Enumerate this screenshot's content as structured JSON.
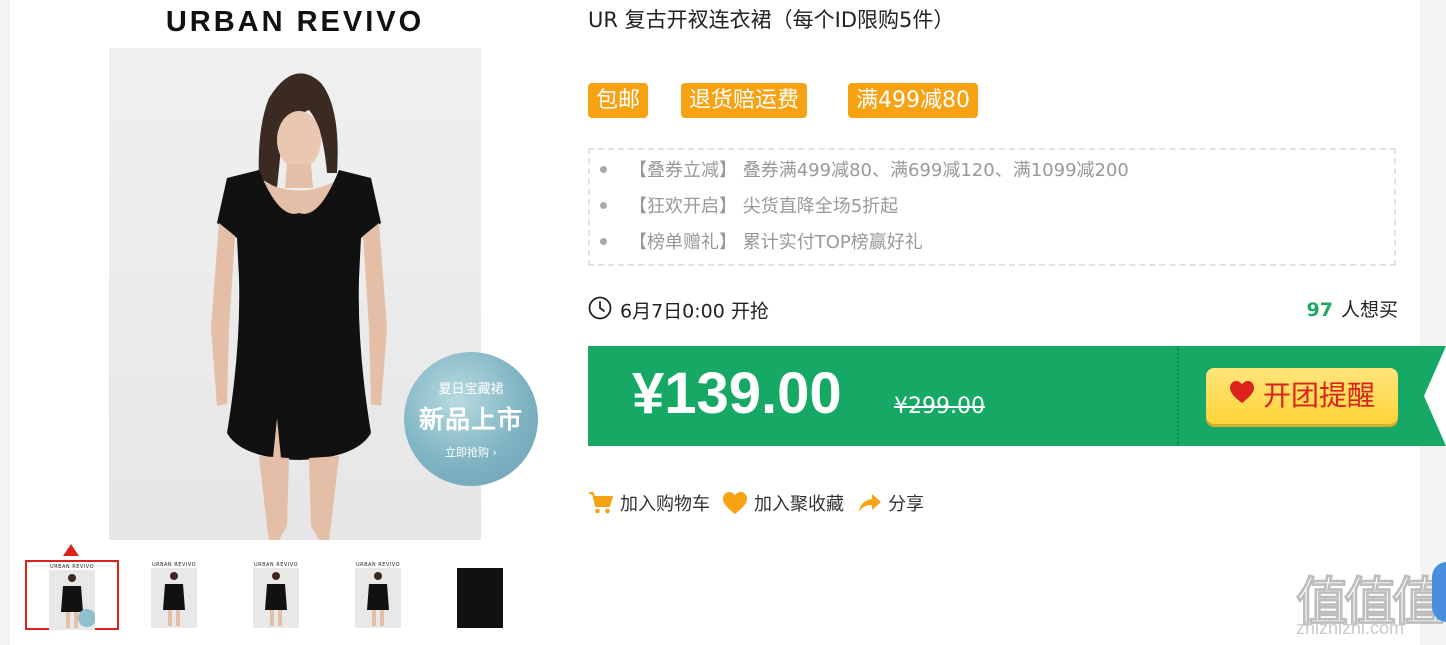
{
  "gallery": {
    "brand": "URBAN REVIVO",
    "badge": {
      "line1": "夏日宝藏裙",
      "line2": "新品上市",
      "line3": "立即抢购 ›"
    },
    "thumbnails": [
      {
        "brand": "URBAN REVIVO",
        "active": true
      },
      {
        "brand": "URBAN REVIVO",
        "active": false
      },
      {
        "brand": "URBAN REVIVO",
        "active": false
      },
      {
        "brand": "URBAN REVIVO",
        "active": false
      },
      {
        "brand": "",
        "active": false
      }
    ]
  },
  "product": {
    "title": "UR 复古开衩连衣裙（每个ID限购5件）",
    "tags": [
      "包邮",
      "退货赔运费",
      "满499减80"
    ],
    "promos": [
      {
        "label": "【叠券立减】",
        "text": "叠券满499减80、满699减120、满1099减200"
      },
      {
        "label": "【狂欢开启】",
        "text": "尖货直降全场5折起"
      },
      {
        "label": "【榜单赠礼】",
        "text": "累计实付TOP榜赢好礼"
      }
    ],
    "start_time": "6月7日0:00 开抢",
    "want_count": "97",
    "want_label": "人想买",
    "price": "¥139.00",
    "original_price": "¥299.00",
    "remind_label": "开团提醒"
  },
  "actions": {
    "cart": "加入购物车",
    "favorite": "加入聚收藏",
    "share": "分享"
  },
  "watermark": {
    "logo": "值值值",
    "url": "zhizhizhi.com"
  },
  "colors": {
    "green": "#16a965",
    "orange": "#f7a213",
    "red": "#d9231c",
    "yellow": "#ffd43a"
  }
}
